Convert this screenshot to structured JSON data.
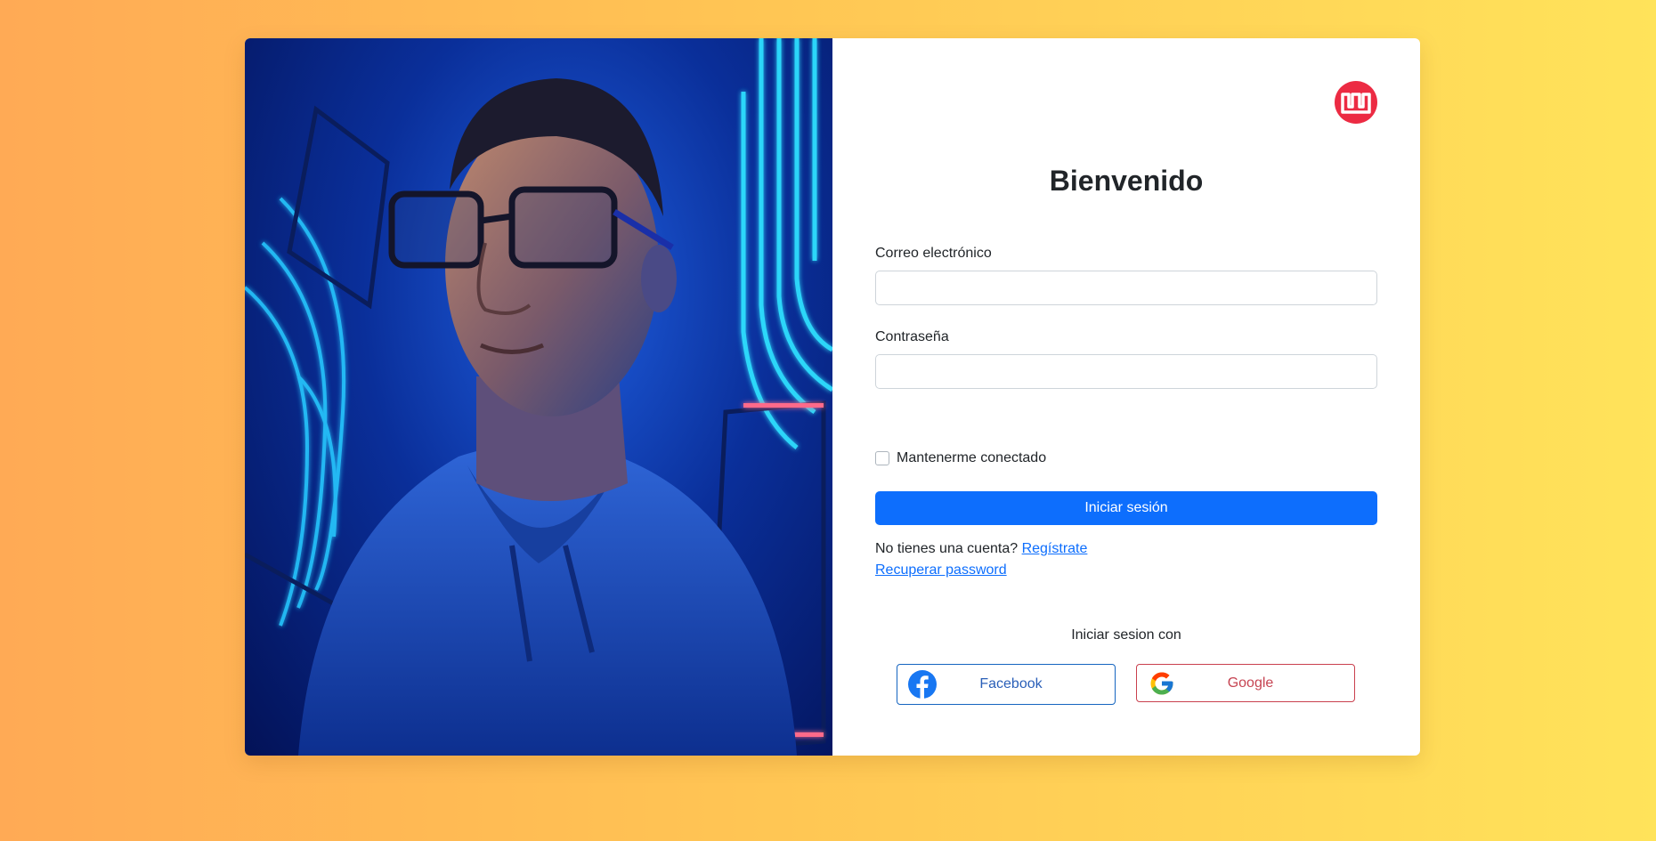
{
  "hero": {
    "alt": "person with glasses in hoodie, neon blue background"
  },
  "brand": {
    "logo_icon": "brand-logo-icon",
    "color": "#ec2b43"
  },
  "form": {
    "title": "Bienvenido",
    "email_label": "Correo electrónico",
    "email_value": "",
    "password_label": "Contraseña",
    "password_value": "",
    "remember_label": "Mantenerme conectado",
    "remember_checked": false,
    "submit_label": "Iniciar sesión",
    "no_account_text": "No tienes una cuenta?",
    "register_link": "Regístrate",
    "recover_link": "Recuperar password"
  },
  "social": {
    "heading": "Iniciar sesion con",
    "facebook_label": "Facebook",
    "google_label": "Google"
  },
  "colors": {
    "primary": "#0d6efd",
    "facebook": "#1877f2",
    "google_border": "#c9404e"
  }
}
